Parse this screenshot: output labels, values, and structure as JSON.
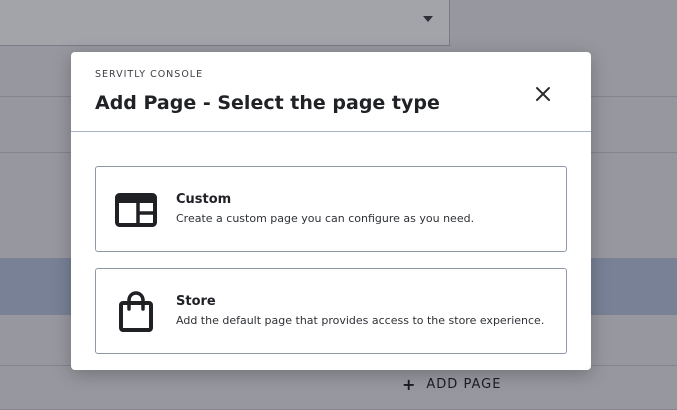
{
  "background": {
    "add_page_icon": "plus-icon",
    "add_page_label": "ADD PAGE"
  },
  "modal": {
    "eyebrow": "SERVITLY CONSOLE",
    "title": "Add Page - Select the page type",
    "close_icon": "close-icon",
    "options": [
      {
        "icon": "layout-icon",
        "title": "Custom",
        "description": "Create a custom page you can configure as you need."
      },
      {
        "icon": "shopping-bag-icon",
        "title": "Store",
        "description": "Add the default page that provides access to the store experience."
      }
    ]
  },
  "colors": {
    "overlay": "#181c28",
    "selected_row": "#b7c5e0",
    "divider": "#a9b3c8",
    "text": "#202226"
  }
}
